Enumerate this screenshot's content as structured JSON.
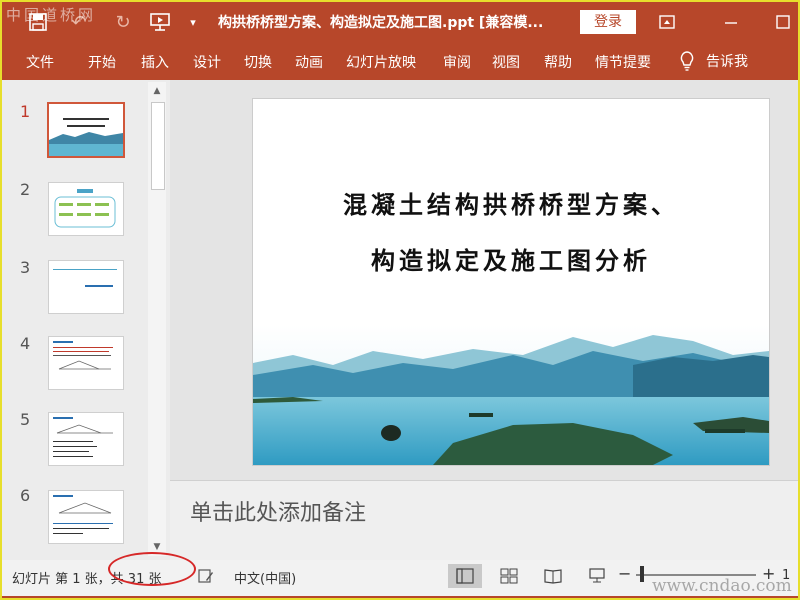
{
  "app": {
    "doc_title": "构拱桥桥型方案、构造拟定及施工图.ppt [兼容模...",
    "login_label": "登录",
    "qa_dropdown": "▾"
  },
  "tabs": [
    "文件",
    "开始",
    "插入",
    "设计",
    "切换",
    "动画",
    "幻灯片放映",
    "审阅",
    "视图",
    "帮助",
    "情节提要"
  ],
  "tell_me": "告诉我",
  "thumbnails": [
    "1",
    "2",
    "3",
    "4",
    "5",
    "6"
  ],
  "slide": {
    "title_line1": "混凝土结构拱桥桥型方案、",
    "title_line2": "构造拟定及施工图分析"
  },
  "notes_placeholder": "单击此处添加备注",
  "status": {
    "slide_count": "幻灯片 第 1 张，共 31 张",
    "language": "中文(中国)",
    "zoom_minus": "−",
    "zoom_plus": "+",
    "zoom_level": "1",
    "zoom_position": 0.05
  },
  "watermarks": {
    "top_left": "中国道桥网",
    "bottom_right": "www.cndao.com"
  },
  "colors": {
    "accent": "#b7472a",
    "selected_thumb": "#d0573a",
    "annotation_oval": "#d62828"
  }
}
